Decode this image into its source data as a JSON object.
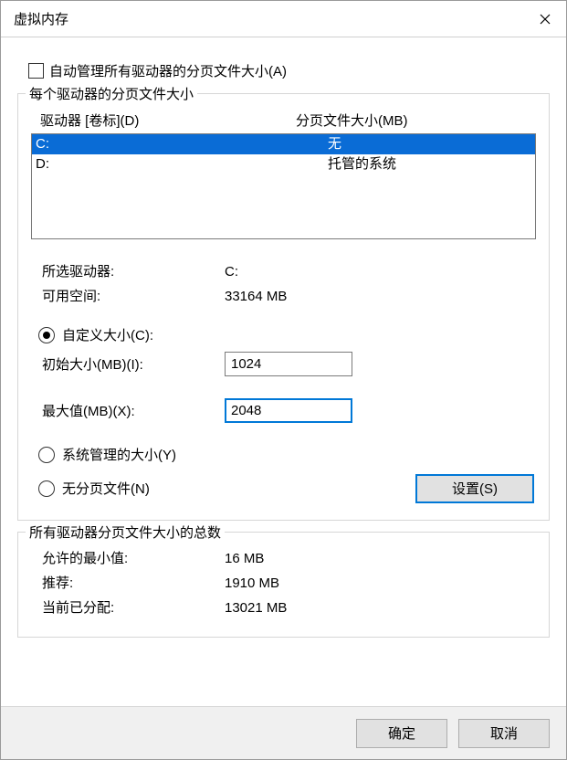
{
  "window": {
    "title": "虚拟内存"
  },
  "auto_manage": {
    "label": "自动管理所有驱动器的分页文件大小(A)",
    "checked": false
  },
  "group_drives": {
    "legend": "每个驱动器的分页文件大小",
    "header_drive": "驱动器 [卷标](D)",
    "header_page": "分页文件大小(MB)",
    "rows": [
      {
        "drive": "C:",
        "page": "无",
        "selected": true
      },
      {
        "drive": "D:",
        "page": "托管的系统",
        "selected": false
      }
    ],
    "selected_drive_label": "所选驱动器:",
    "selected_drive_value": "C:",
    "free_space_label": "可用空间:",
    "free_space_value": "33164 MB",
    "radio_custom": "自定义大小(C):",
    "initial_label": "初始大小(MB)(I):",
    "initial_value": "1024",
    "max_label": "最大值(MB)(X):",
    "max_value": "2048",
    "radio_system": "系统管理的大小(Y)",
    "radio_none": "无分页文件(N)",
    "set_button": "设置(S)"
  },
  "group_totals": {
    "legend": "所有驱动器分页文件大小的总数",
    "min_label": "允许的最小值:",
    "min_value": "16 MB",
    "rec_label": "推荐:",
    "rec_value": "1910 MB",
    "cur_label": "当前已分配:",
    "cur_value": "13021 MB"
  },
  "footer": {
    "ok": "确定",
    "cancel": "取消"
  }
}
